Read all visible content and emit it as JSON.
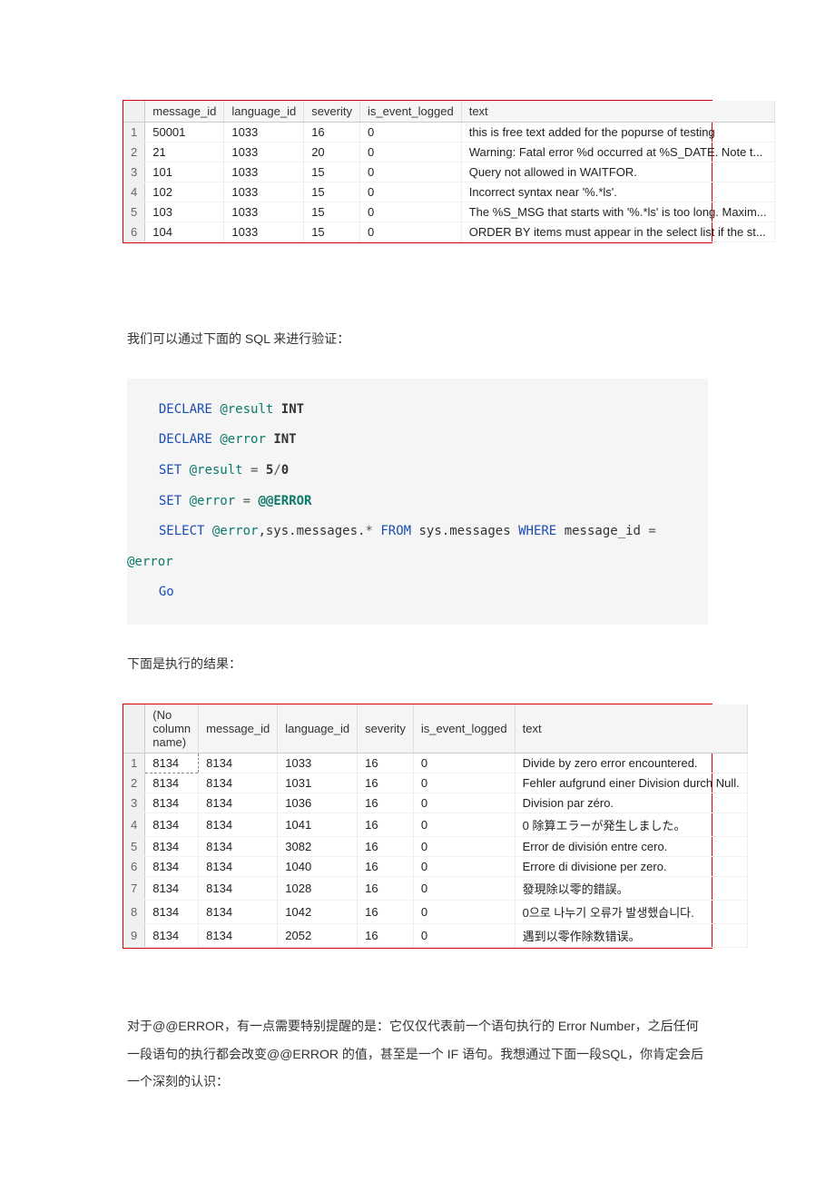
{
  "table1": {
    "headers": [
      "message_id",
      "language_id",
      "severity",
      "is_event_logged",
      "text"
    ],
    "rows": [
      {
        "n": "1",
        "message_id": "50001",
        "language_id": "1033",
        "severity": "16",
        "is_event_logged": "0",
        "text": "this is free text added for the popurse of testing"
      },
      {
        "n": "2",
        "message_id": "21",
        "language_id": "1033",
        "severity": "20",
        "is_event_logged": "0",
        "text": "Warning: Fatal error %d occurred at %S_DATE. Note t..."
      },
      {
        "n": "3",
        "message_id": "101",
        "language_id": "1033",
        "severity": "15",
        "is_event_logged": "0",
        "text": "Query not allowed in WAITFOR."
      },
      {
        "n": "4",
        "message_id": "102",
        "language_id": "1033",
        "severity": "15",
        "is_event_logged": "0",
        "text": "Incorrect syntax near '%.*ls'."
      },
      {
        "n": "5",
        "message_id": "103",
        "language_id": "1033",
        "severity": "15",
        "is_event_logged": "0",
        "text": "The %S_MSG that starts with '%.*ls' is too long. Maxim..."
      },
      {
        "n": "6",
        "message_id": "104",
        "language_id": "1033",
        "severity": "15",
        "is_event_logged": "0",
        "text": "ORDER BY items must appear in the select list if the st..."
      }
    ]
  },
  "para1": "我们可以通过下面的 SQL 来进行验证：",
  "code": {
    "l1a": "DECLARE",
    "l1b": "@result",
    "l1c": "INT",
    "l2a": "DECLARE",
    "l2b": "@error",
    "l2c": "INT",
    "l3a": "SET",
    "l3b": "@result",
    "l3eq": "=",
    "l3c": "5",
    "l3d": "/",
    "l3e": "0",
    "l4a": "SET",
    "l4b": "@error",
    "l4eq": "=",
    "l4c": "@@ERROR",
    "l5a": "SELECT",
    "l5b": "@error",
    "l5c": ",sys.messages.",
    "l5star": "*",
    "l5d": "FROM",
    "l5e": "sys.messages",
    "l5f": "WHERE",
    "l5g": "message_id",
    "l5eq": "=",
    "l6": "@error",
    "l7": "Go"
  },
  "para2": "下面是执行的结果：",
  "table2": {
    "headers": [
      "(No column name)",
      "message_id",
      "language_id",
      "severity",
      "is_event_logged",
      "text"
    ],
    "rows": [
      {
        "n": "1",
        "c0": "8134",
        "c1": "8134",
        "c2": "1033",
        "c3": "16",
        "c4": "0",
        "c5": "Divide by zero error encountered."
      },
      {
        "n": "2",
        "c0": "8134",
        "c1": "8134",
        "c2": "1031",
        "c3": "16",
        "c4": "0",
        "c5": "Fehler aufgrund einer Division durch Null."
      },
      {
        "n": "3",
        "c0": "8134",
        "c1": "8134",
        "c2": "1036",
        "c3": "16",
        "c4": "0",
        "c5": "Division par zéro."
      },
      {
        "n": "4",
        "c0": "8134",
        "c1": "8134",
        "c2": "1041",
        "c3": "16",
        "c4": "0",
        "c5": "0 除算エラーが発生しました。"
      },
      {
        "n": "5",
        "c0": "8134",
        "c1": "8134",
        "c2": "3082",
        "c3": "16",
        "c4": "0",
        "c5": "Error de división entre cero."
      },
      {
        "n": "6",
        "c0": "8134",
        "c1": "8134",
        "c2": "1040",
        "c3": "16",
        "c4": "0",
        "c5": "Errore di divisione per zero."
      },
      {
        "n": "7",
        "c0": "8134",
        "c1": "8134",
        "c2": "1028",
        "c3": "16",
        "c4": "0",
        "c5": "發現除以零的錯誤。"
      },
      {
        "n": "8",
        "c0": "8134",
        "c1": "8134",
        "c2": "1042",
        "c3": "16",
        "c4": "0",
        "c5": "0으로 나누기 오류가 발생했습니다."
      },
      {
        "n": "9",
        "c0": "8134",
        "c1": "8134",
        "c2": "2052",
        "c3": "16",
        "c4": "0",
        "c5": "遇到以零作除数错误。"
      }
    ]
  },
  "para3": "对于@@ERROR，有一点需要特别提醒的是：它仅仅代表前一个语句执行的 Error Number，之后任何一段语句的执行都会改变@@ERROR 的值，甚至是一个 IF 语句。我想通过下面一段SQL，你肯定会后一个深刻的认识："
}
